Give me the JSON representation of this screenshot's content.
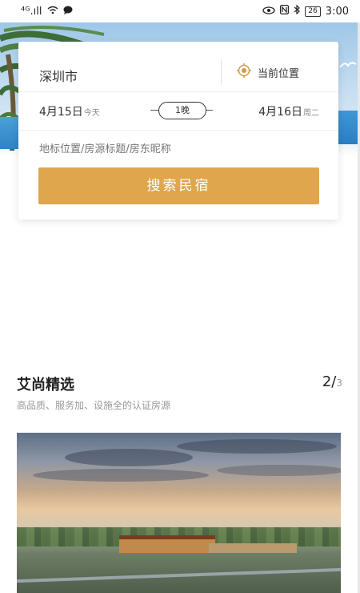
{
  "status_bar": {
    "signal": "⁴ᴳ.ıll",
    "time": "3:00",
    "battery": "26"
  },
  "search_card": {
    "city": "深圳市",
    "current_location_label": "当前位置",
    "check_in": {
      "date": "4月15日",
      "day": "今天"
    },
    "check_out": {
      "date": "4月16日",
      "day": "周二"
    },
    "nights": "1晚",
    "search_placeholder": "地标位置/房源标题/房东昵称",
    "search_button": "搜索民宿"
  },
  "featured": {
    "title": "艾尚精选",
    "subtitle": "高品质、服务加、设施全的认证房源",
    "page_current": "2/",
    "page_total": "3"
  },
  "colors": {
    "accent": "#e0a64d",
    "location_icon": "#d59a3f"
  },
  "icons": {
    "location": "target-icon",
    "wifi": "wifi-icon",
    "chat": "chat-icon",
    "eye": "eye-icon",
    "nfc": "nfc-icon",
    "bluetooth": "bluetooth-icon"
  }
}
